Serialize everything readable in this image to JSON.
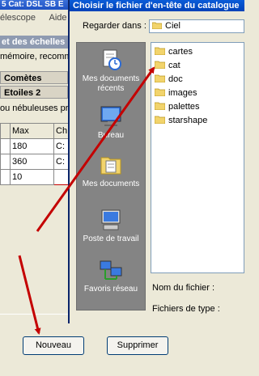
{
  "background_window": {
    "title": "5 Cat: DSL SB E",
    "menu": [
      "élescope",
      "Aide"
    ],
    "panel_header": "et des échelles",
    "memory_text": "mémoire, recomma",
    "tabs": [
      "Comètes",
      "Etoiles 2"
    ],
    "nebula_text": "ou nébuleuses pr",
    "table": {
      "headers": [
        "",
        "Max",
        "Ch"
      ],
      "rows": [
        [
          "",
          "180",
          "C:"
        ],
        [
          "",
          "360",
          "C:"
        ],
        [
          "",
          "10",
          ""
        ]
      ]
    },
    "buttons": {
      "new": "Nouveau",
      "delete": "Supprimer"
    }
  },
  "dialog": {
    "title": "Choisir le fichier d'en-tête du catalogue",
    "look_in_label": "Regarder dans :",
    "look_in_value": "Ciel",
    "places": [
      {
        "label": "Mes documents récents",
        "icon": "recent-documents-icon"
      },
      {
        "label": "Bureau",
        "icon": "desktop-icon"
      },
      {
        "label": "Mes documents",
        "icon": "my-documents-icon"
      },
      {
        "label": "Poste de travail",
        "icon": "my-computer-icon"
      },
      {
        "label": "Favoris réseau",
        "icon": "network-places-icon"
      }
    ],
    "files": [
      "cartes",
      "cat",
      "doc",
      "images",
      "palettes",
      "starshape"
    ],
    "filename_label": "Nom du fichier :",
    "filetype_label": "Fichiers de type :"
  },
  "colors": {
    "window_bg": "#ece9d8",
    "places_bg": "#848484",
    "titlebar": "#0a5cd8",
    "arrow": "#c40000",
    "folder": "#f2d46c"
  }
}
